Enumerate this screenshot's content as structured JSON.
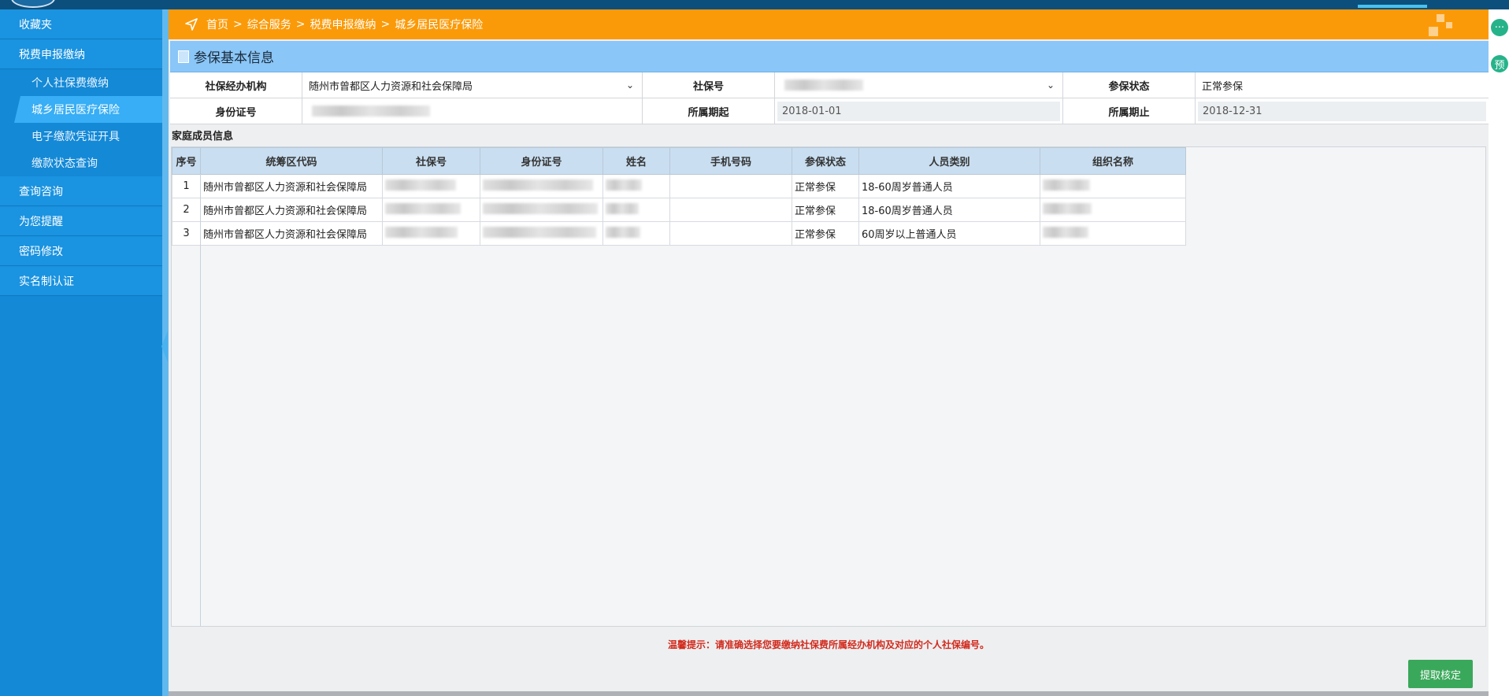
{
  "sidebar": {
    "items": [
      {
        "label": "收藏夹"
      },
      {
        "label": "税费申报缴纳"
      }
    ],
    "subitems": [
      {
        "label": "个人社保费缴纳"
      },
      {
        "label": "城乡居民医疗保险"
      },
      {
        "label": "电子缴款凭证开具"
      },
      {
        "label": "缴款状态查询"
      }
    ],
    "bottom_items": [
      {
        "label": "查询咨询"
      },
      {
        "label": "为您提醒"
      },
      {
        "label": "密码修改"
      },
      {
        "label": "实名制认证"
      }
    ]
  },
  "breadcrumb": {
    "home": "首页",
    "sep": ">",
    "c1": "综合服务",
    "c2": "税费申报缴纳",
    "c3": "城乡居民医疗保险"
  },
  "section": {
    "title": "参保基本信息"
  },
  "form": {
    "agency_label": "社保经办机构",
    "agency_value": "随州市曾都区人力资源和社会保障局",
    "ssn_label": "社保号",
    "status_label": "参保状态",
    "status_value": "正常参保",
    "id_label": "身份证号",
    "start_label": "所属期起",
    "start_value": "2018-01-01",
    "end_label": "所属期止",
    "end_value": "2018-12-31"
  },
  "family": {
    "title": "家庭成员信息",
    "columns": [
      "序号",
      "统筹区代码",
      "社保号",
      "身份证号",
      "姓名",
      "手机号码",
      "参保状态",
      "人员类别",
      "组织名称"
    ],
    "rows": [
      {
        "no": "1",
        "region": "随州市曾都区人力资源和社会保障局",
        "status": "正常参保",
        "category": "18-60周岁普通人员"
      },
      {
        "no": "2",
        "region": "随州市曾都区人力资源和社会保障局",
        "status": "正常参保",
        "category": "18-60周岁普通人员"
      },
      {
        "no": "3",
        "region": "随州市曾都区人力资源和社会保障局",
        "status": "正常参保",
        "category": "60周岁以上普通人员"
      }
    ]
  },
  "hint": "温馨提示：请准确选择您要缴纳社保费所属经办机构及对应的个人社保编号。",
  "submit_label": "提取核定",
  "right_rail": {
    "chat": "···",
    "preview": "预"
  },
  "colors": {
    "orange": "#fb9a08",
    "sidebar": "#1489d6",
    "active": "#37aef5",
    "header": "#8ac6f7"
  },
  "icons": [
    "navigation-arrow-icon",
    "document-icon",
    "chevron-down-icon",
    "chat-icon",
    "preview-icon"
  ]
}
